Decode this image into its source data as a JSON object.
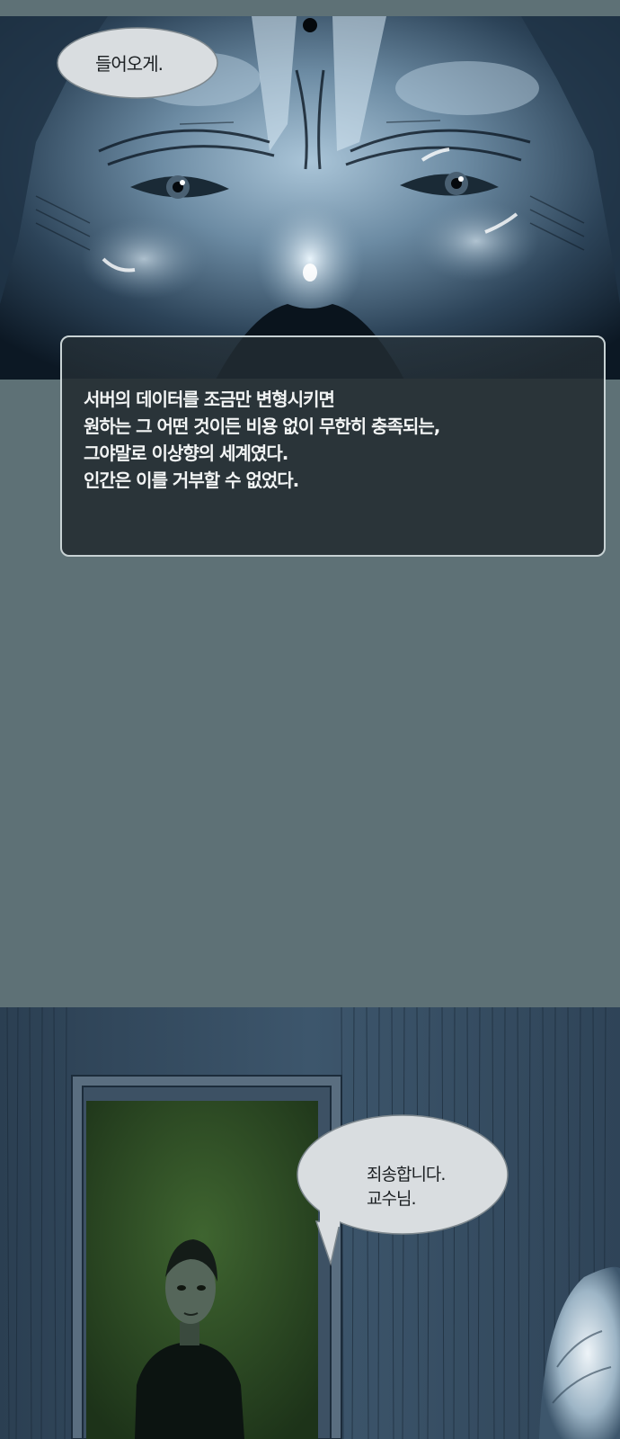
{
  "bubble_top": {
    "text": "들어오게."
  },
  "narration": {
    "lines": [
      "서버의 데이터를 조금만 변형시키면",
      "원하는 그 어떤 것이든 비용 없이 무한히 충족되는,",
      "그야말로 이상향의 세계였다.",
      "인간은 이를 거부할 수 없었다."
    ]
  },
  "bubble_bottom": {
    "lines": [
      "죄송합니다.",
      "교수님."
    ]
  },
  "colors": {
    "page_background": "#5e7176",
    "narration_background": "#2a3439",
    "narration_border": "#c8d2d4",
    "narration_text": "#f2f4f4",
    "bubble_fill": "#d9dde0",
    "doorway_green": "#2d4b24"
  }
}
